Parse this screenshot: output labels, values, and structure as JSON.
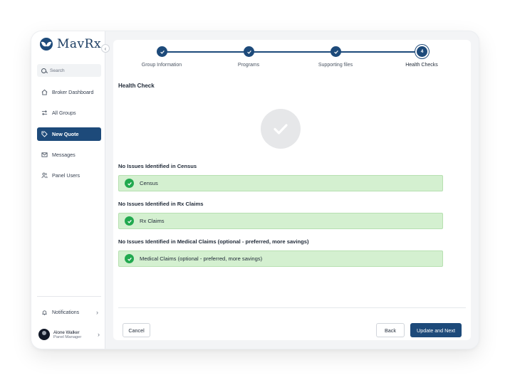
{
  "brand": {
    "name": "MavRx"
  },
  "sidebar": {
    "search_placeholder": "Search",
    "items": [
      {
        "label": "Broker Dashboard",
        "icon": "home-icon",
        "active": false
      },
      {
        "label": "All Groups",
        "icon": "swap-icon",
        "active": false
      },
      {
        "label": "New Quote",
        "icon": "tag-icon",
        "active": true
      },
      {
        "label": "Messages",
        "icon": "mail-icon",
        "active": false
      },
      {
        "label": "Panel Users",
        "icon": "users-icon",
        "active": false
      }
    ],
    "notifications_label": "Notifications",
    "user": {
      "name": "Alone Walker",
      "role": "Panel Manager"
    }
  },
  "stepper": {
    "steps": [
      {
        "label": "Group Information",
        "status": "complete"
      },
      {
        "label": "Programs",
        "status": "complete"
      },
      {
        "label": "Supporting files",
        "status": "complete"
      },
      {
        "label": "Health Checks",
        "status": "current",
        "number": "4"
      }
    ]
  },
  "health": {
    "title": "Health Check",
    "checks": [
      {
        "heading": "No Issues Identified in Census",
        "status_text": "Census"
      },
      {
        "heading": "No Issues Identified in Rx Claims",
        "status_text": "Rx Claims"
      },
      {
        "heading": "No Issues Identified in Medical Claims (optional - preferred, more savings)",
        "status_text": "Medical Claims (optional - preferred, more savings)"
      }
    ]
  },
  "footer": {
    "cancel_label": "Cancel",
    "back_label": "Back",
    "next_label": "Update and Next"
  },
  "colors": {
    "primary": "#1d4a7a",
    "success": "#22a94f",
    "success_bg": "#d4f0d0"
  }
}
